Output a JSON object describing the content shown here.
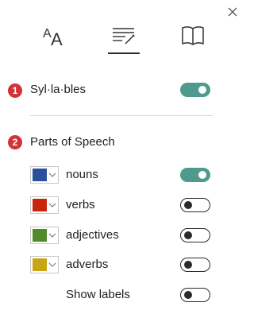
{
  "header": {
    "close_icon": "close-icon",
    "tabs": [
      {
        "icon": "text-size-icon",
        "active": false
      },
      {
        "icon": "grammar-options-icon",
        "active": true
      },
      {
        "icon": "book-icon",
        "active": false
      }
    ]
  },
  "syllables": {
    "badge": "1",
    "label": "Syl·la·bles",
    "enabled": true
  },
  "parts_of_speech": {
    "badge": "2",
    "label": "Parts of Speech",
    "items": [
      {
        "label": "nouns",
        "color": "#2b4f9a",
        "enabled": true
      },
      {
        "label": "verbs",
        "color": "#c8250f",
        "enabled": false
      },
      {
        "label": "adjectives",
        "color": "#4f8a2b",
        "enabled": false
      },
      {
        "label": "adverbs",
        "color": "#c8a514",
        "enabled": false
      }
    ],
    "show_labels": {
      "label": "Show labels",
      "enabled": false
    }
  },
  "colors": {
    "toggle_on": "#4f9a8e",
    "badge": "#d13438"
  }
}
